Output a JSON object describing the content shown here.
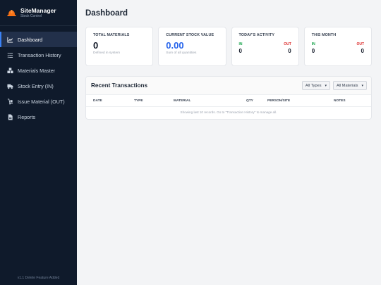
{
  "brand": {
    "name": "SiteManager",
    "subtitle": "Stock Control"
  },
  "nav": [
    {
      "label": "Dashboard",
      "icon": "chart-line-icon",
      "active": true
    },
    {
      "label": "Transaction History",
      "icon": "list-icon"
    },
    {
      "label": "Materials Master",
      "icon": "boxes-icon"
    },
    {
      "label": "Stock Entry (IN)",
      "icon": "truck-icon"
    },
    {
      "label": "Issue Material (OUT)",
      "icon": "dolly-icon"
    },
    {
      "label": "Reports",
      "icon": "file-icon"
    }
  ],
  "version": "v1.1 Delete Feature Added",
  "page": {
    "title": "Dashboard"
  },
  "cards": {
    "total_materials": {
      "label": "TOTAL MATERIALS",
      "value": "0",
      "sub": "Defined in system"
    },
    "stock_value": {
      "label": "CURRENT STOCK VALUE",
      "value": "0.00",
      "sub": "Sum of all quantities"
    },
    "today": {
      "label": "TODAY'S ACTIVITY",
      "in_label": "IN",
      "in_value": "0",
      "out_label": "OUT",
      "out_value": "0"
    },
    "month": {
      "label": "THIS MONTH",
      "in_label": "IN",
      "in_value": "0",
      "out_label": "OUT",
      "out_value": "0"
    }
  },
  "recent": {
    "title": "Recent Transactions",
    "filter_type": "All Types",
    "filter_material": "All Materials",
    "columns": [
      "DATE",
      "TYPE",
      "MATERIAL",
      "QTY",
      "PERSON/SITE",
      "NOTES"
    ],
    "note": "Showing last 10 records. Go to \"Transaction History\" to manage all."
  },
  "colors": {
    "sidebar": "#0f1a2b",
    "accent": "#3b82f6",
    "value_blue": "#2563eb",
    "in": "#16a34a",
    "out": "#dc2626",
    "brand_icon": "#f97316"
  }
}
